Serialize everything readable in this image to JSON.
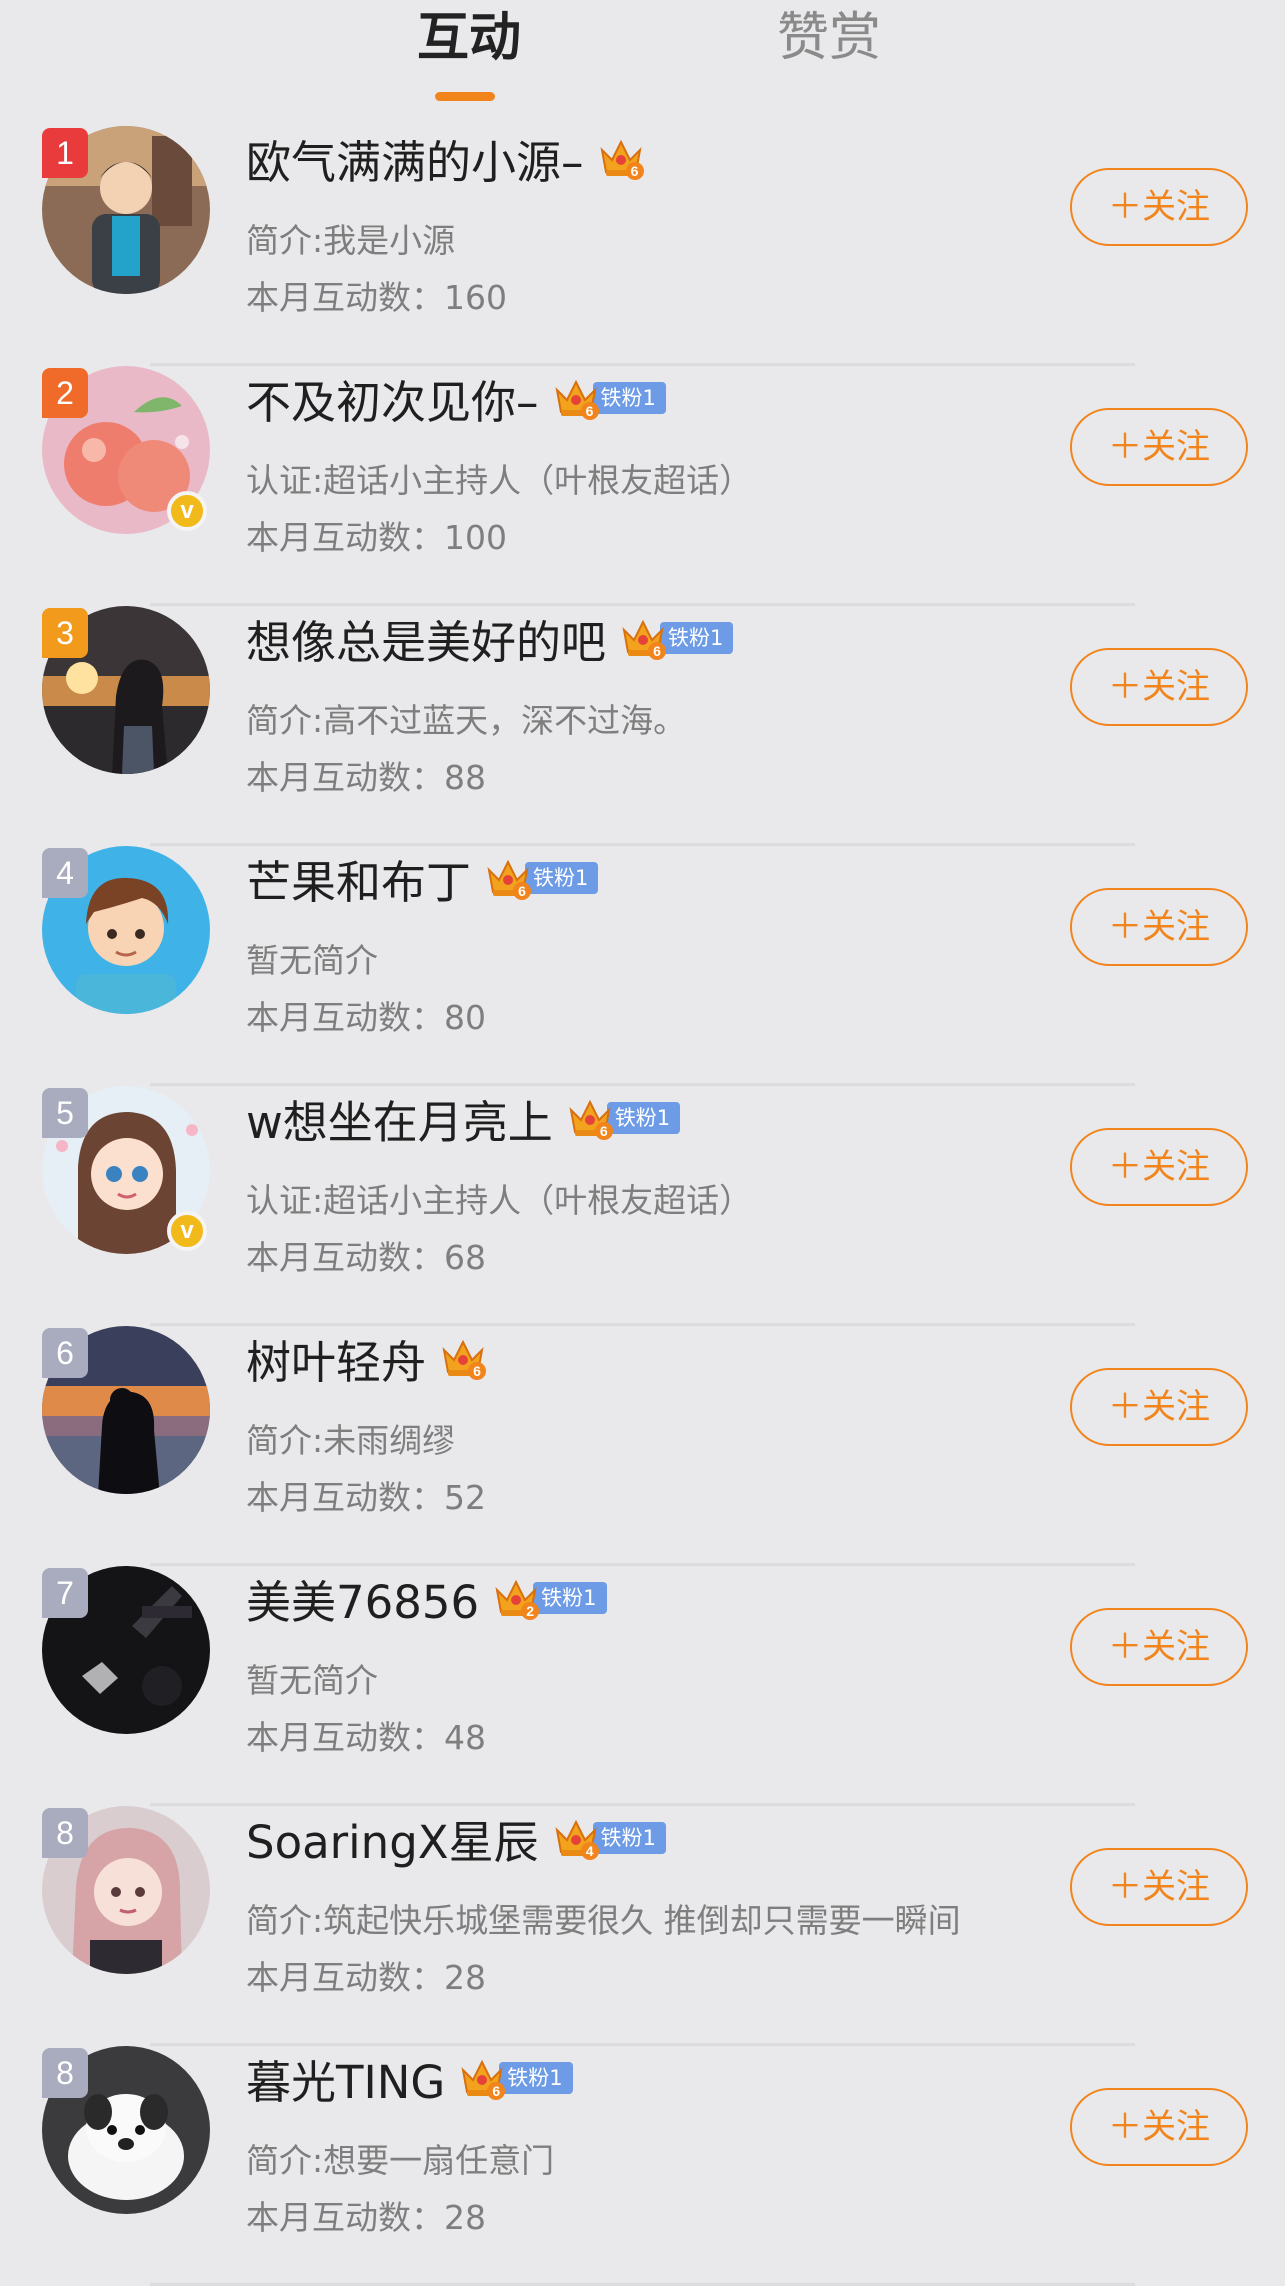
{
  "tabs": [
    {
      "label": "互动",
      "active": true
    },
    {
      "label": "赞赏",
      "active": false
    }
  ],
  "colors": {
    "accent": "#f2841c",
    "rank1": "#e93b3b",
    "rank2": "#f06a2a",
    "rank3": "#f29a1c",
    "rank_other": "#a9acbe",
    "fan_tag": "#6d9be6",
    "verified": "#f2b91a"
  },
  "follow_label": "＋关注",
  "users": [
    {
      "rank": "1",
      "name": "欧气满满的小源–",
      "crown_level": "6",
      "fan_tag": "",
      "verified": false,
      "intro": "简介:我是小源",
      "count": "本月互动数：160",
      "avatar_icon": "boy-avatar-icon"
    },
    {
      "rank": "2",
      "name": "不及初次见你–",
      "crown_level": "6",
      "fan_tag": "铁粉1",
      "verified": true,
      "intro": "认证:超话小主持人（叶根友超话）",
      "count": "本月互动数：100",
      "avatar_icon": "peach-avatar-icon"
    },
    {
      "rank": "3",
      "name": "想像总是美好的吧",
      "crown_level": "6",
      "fan_tag": "铁粉1",
      "verified": false,
      "intro": "简介:高不过蓝天，深不过海。",
      "count": "本月互动数：88",
      "avatar_icon": "sunset-girl-avatar-icon"
    },
    {
      "rank": "4",
      "name": "芒果和布丁",
      "crown_level": "6",
      "fan_tag": "铁粉1",
      "verified": false,
      "intro": "暂无简介",
      "count": "本月互动数：80",
      "avatar_icon": "cartoon-boy-avatar-icon"
    },
    {
      "rank": "5",
      "name": "w想坐在月亮上",
      "crown_level": "6",
      "fan_tag": "铁粉1",
      "verified": true,
      "intro": "认证:超话小主持人（叶根友超话）",
      "count": "本月互动数：68",
      "avatar_icon": "cartoon-girl-avatar-icon"
    },
    {
      "rank": "6",
      "name": "树叶轻舟",
      "crown_level": "6",
      "fan_tag": "",
      "verified": false,
      "intro": "简介:未雨绸缪",
      "count": "本月互动数：52",
      "avatar_icon": "silhouette-avatar-icon"
    },
    {
      "rank": "7",
      "name": "美美76856",
      "crown_level": "2",
      "fan_tag": "铁粉1",
      "verified": false,
      "intro": "暂无简介",
      "count": "本月互动数：48",
      "avatar_icon": "dark-hand-avatar-icon"
    },
    {
      "rank": "8",
      "name": "SoaringX星辰",
      "crown_level": "4",
      "fan_tag": "铁粉1",
      "verified": false,
      "intro": "简介:筑起快乐城堡需要很久 推倒却只需要一瞬间",
      "count": "本月互动数：28",
      "avatar_icon": "anime-girl-avatar-icon"
    },
    {
      "rank": "8",
      "name": "暮光TING",
      "crown_level": "6",
      "fan_tag": "铁粉1",
      "verified": false,
      "intro": "简介:想要一扇任意门",
      "count": "本月互动数：28",
      "avatar_icon": "puppy-avatar-icon"
    }
  ]
}
